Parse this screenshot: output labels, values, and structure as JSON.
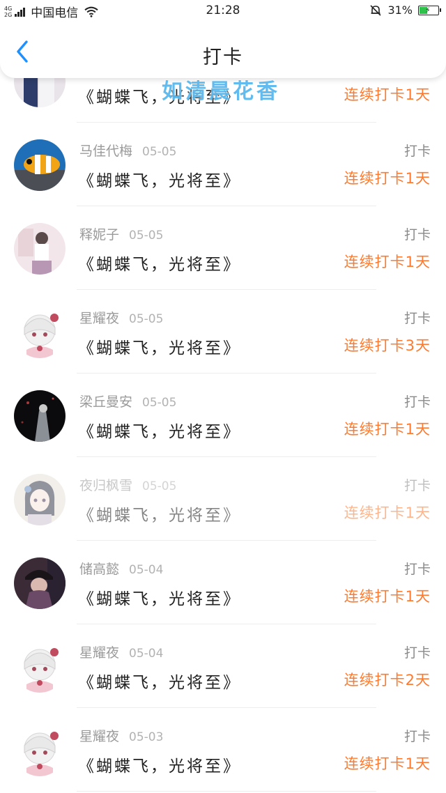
{
  "status_bar": {
    "network_top": "4G",
    "network_bottom": "2G",
    "carrier": "中国电信",
    "time": "21:28",
    "battery": "31%"
  },
  "header": {
    "title": "打卡"
  },
  "watermark": "如清晨花香",
  "records": [
    {
      "name": "",
      "date": "",
      "book": "《蝴蝶飞，光将至》",
      "action": "",
      "streak": "连续打卡1天",
      "avatar": "girl-photo"
    },
    {
      "name": "马佳代梅",
      "date": "05-05",
      "book": "《蝴蝶飞，光将至》",
      "action": "打卡",
      "streak": "连续打卡1天",
      "avatar": "clownfish"
    },
    {
      "name": "释妮子",
      "date": "05-05",
      "book": "《蝴蝶飞，光将至》",
      "action": "打卡",
      "streak": "连续打卡1天",
      "avatar": "girl-pink"
    },
    {
      "name": "星耀夜",
      "date": "05-05",
      "book": "《蝴蝶飞，光将至》",
      "action": "打卡",
      "streak": "连续打卡3天",
      "avatar": "anime-bow"
    },
    {
      "name": "梁丘曼安",
      "date": "05-05",
      "book": "《蝴蝶飞，光将至》",
      "action": "打卡",
      "streak": "连续打卡1天",
      "avatar": "dark-night"
    },
    {
      "name": "夜归枫雪",
      "date": "05-05",
      "book": "《蝴蝶飞，光将至》",
      "action": "打卡",
      "streak": "连续打卡1天",
      "avatar": "anime-dark"
    },
    {
      "name": "储高懿",
      "date": "05-04",
      "book": "《蝴蝶飞，光将至》",
      "action": "打卡",
      "streak": "连续打卡1天",
      "avatar": "girl-cap"
    },
    {
      "name": "星耀夜",
      "date": "05-04",
      "book": "《蝴蝶飞，光将至》",
      "action": "打卡",
      "streak": "连续打卡2天",
      "avatar": "anime-bow"
    },
    {
      "name": "星耀夜",
      "date": "05-03",
      "book": "《蝴蝶飞，光将至》",
      "action": "打卡",
      "streak": "连续打卡1天",
      "avatar": "anime-bow"
    }
  ],
  "colors": {
    "streak": "#ff7a2e",
    "back_icon": "#1e90ff",
    "watermark": "#5ab8ee"
  }
}
